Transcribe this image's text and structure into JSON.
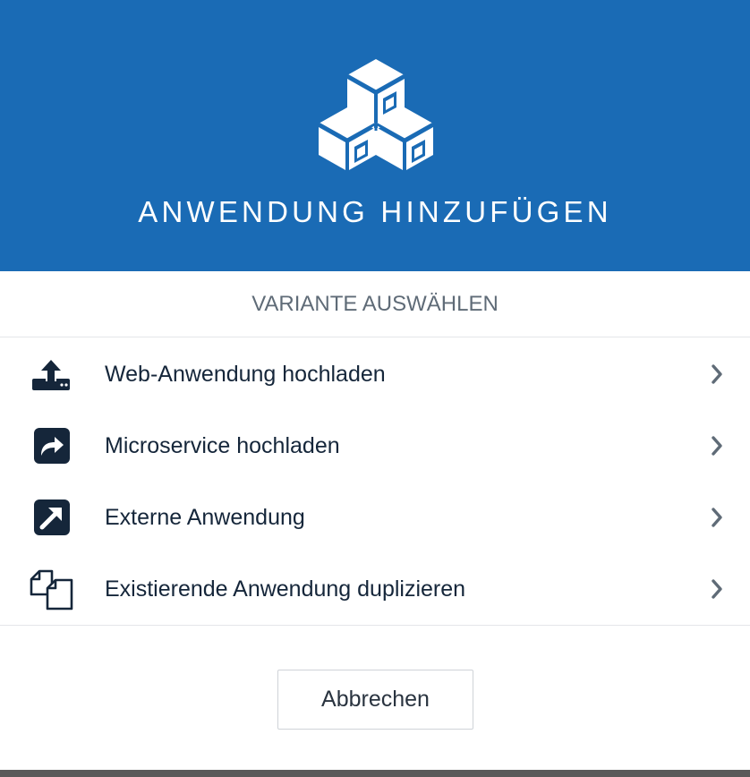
{
  "header": {
    "title": "ANWENDUNG HINZUFÜGEN",
    "icon": "cubes-icon",
    "background_color": "#1a6bb5"
  },
  "subheader": {
    "label": "VARIANTE AUSWÄHLEN"
  },
  "options": [
    {
      "label": "Web-Anwendung hochladen",
      "icon": "upload-icon"
    },
    {
      "label": "Microservice hochladen",
      "icon": "share-icon"
    },
    {
      "label": "Externe Anwendung",
      "icon": "external-link-icon"
    },
    {
      "label": "Existierende Anwendung duplizieren",
      "icon": "duplicate-icon"
    }
  ],
  "footer": {
    "cancel_label": "Abbrechen"
  },
  "colors": {
    "accent": "#1a6bb5",
    "icon_dark": "#15263a",
    "chevron": "#5f6b77"
  }
}
